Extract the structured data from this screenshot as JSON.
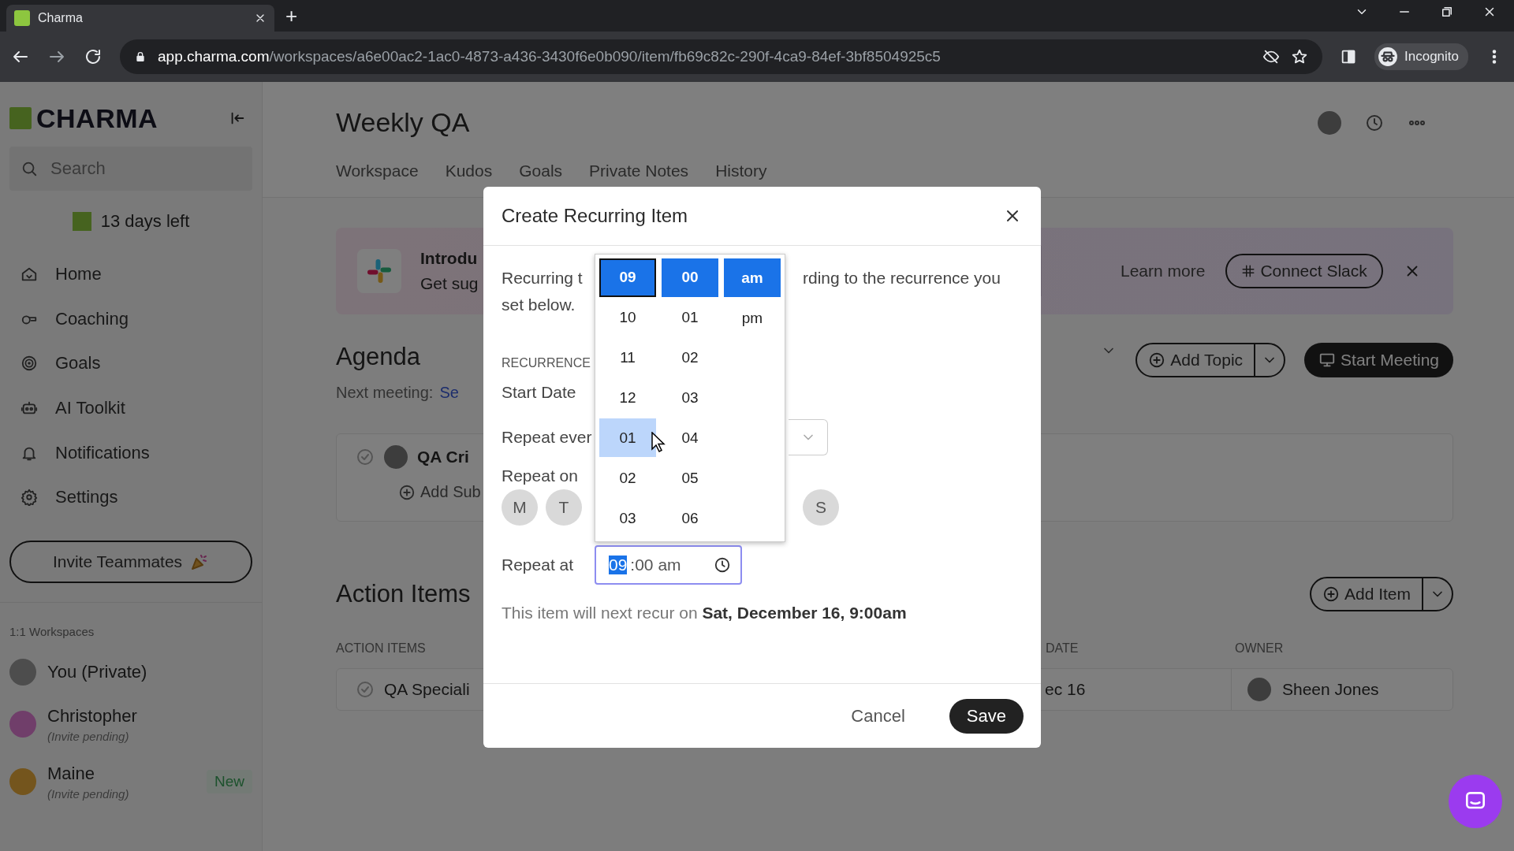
{
  "browser": {
    "tab_title": "Charma",
    "new_tab": "+",
    "url_host": "app.charma.com",
    "url_path": "/workspaces/a6e00ac2-1ac0-4873-a436-3430f6e0b090/item/fb69c82c-290f-4ca9-84ef-3bf8504925c5",
    "profile": "Incognito"
  },
  "sidebar": {
    "logo": "CHARMA",
    "search": {
      "placeholder": "Search"
    },
    "trial": "13 days left",
    "nav": [
      "Home",
      "Coaching",
      "Goals",
      "AI Toolkit",
      "Notifications",
      "Settings"
    ],
    "invite": "Invite Teammates",
    "workspaces_heading": "1:1 Workspaces",
    "workspaces": [
      {
        "name": "You (Private)",
        "color": "#4d4d4d"
      },
      {
        "name": "Christopher",
        "note": "(Invite pending)",
        "color": "#703e6a"
      },
      {
        "name": "Maine",
        "note": "(Invite pending)",
        "badge": "New",
        "color": "#74551d"
      }
    ]
  },
  "page": {
    "title": "Weekly QA",
    "tabs": [
      "Workspace",
      "Kudos",
      "Goals",
      "Private Notes",
      "History"
    ],
    "banner": {
      "title": "Introdu",
      "subtitle": "Get sug",
      "link": "Learn more",
      "button": "Connect Slack"
    },
    "agenda": {
      "heading": "Agenda",
      "next_label": "Next meeting:",
      "next_value": "Se",
      "add_topic": "Add Topic",
      "start_meeting": "Start Meeting",
      "item": "QA Cri",
      "add_sub": "Add Sub"
    },
    "action_items": {
      "heading": "Action Items",
      "add_item": "Add Item",
      "columns": [
        "ACTION ITEMS",
        "DATE",
        "OWNER"
      ],
      "rows": [
        {
          "title": "QA Speciali",
          "date": "ec 16",
          "owner": "Sheen Jones"
        }
      ]
    }
  },
  "modal": {
    "title": "Create Recurring Item",
    "intro_left": "Recurring t",
    "intro_right": "rding to the recurrence you",
    "intro_line2": "set below.",
    "section": "RECURRENCE",
    "start_date": "Start Date",
    "repeat_every": "Repeat ever",
    "repeat_on": "Repeat on",
    "days": [
      "M",
      "T",
      "S"
    ],
    "repeat_at": "Repeat at",
    "time": {
      "hour": "09",
      "rest": ":00 am"
    },
    "next_recur": "This item will next recur on **Sat, December 16, 9:00am**",
    "cancel": "Cancel",
    "save": "Save"
  },
  "picker": {
    "columns": [
      {
        "focused": true,
        "options": [
          {
            "label": "09",
            "selected": true,
            "hovered": false
          },
          {
            "label": "10",
            "selected": false,
            "hovered": false
          },
          {
            "label": "11",
            "selected": false,
            "hovered": false
          },
          {
            "label": "12",
            "selected": false,
            "hovered": false
          },
          {
            "label": "01",
            "selected": false,
            "hovered": true
          },
          {
            "label": "02",
            "selected": false,
            "hovered": false
          },
          {
            "label": "03",
            "selected": false,
            "hovered": false
          }
        ]
      },
      {
        "focused": false,
        "options": [
          {
            "label": "00",
            "selected": true,
            "hovered": false
          },
          {
            "label": "01",
            "selected": false,
            "hovered": false
          },
          {
            "label": "02",
            "selected": false,
            "hovered": false
          },
          {
            "label": "03",
            "selected": false,
            "hovered": false
          },
          {
            "label": "04",
            "selected": false,
            "hovered": false
          },
          {
            "label": "05",
            "selected": false,
            "hovered": false
          },
          {
            "label": "06",
            "selected": false,
            "hovered": false
          }
        ]
      },
      {
        "focused": false,
        "options": [
          {
            "label": "am",
            "selected": true,
            "hovered": false
          },
          {
            "label": "pm",
            "selected": false,
            "hovered": false
          }
        ]
      }
    ]
  }
}
